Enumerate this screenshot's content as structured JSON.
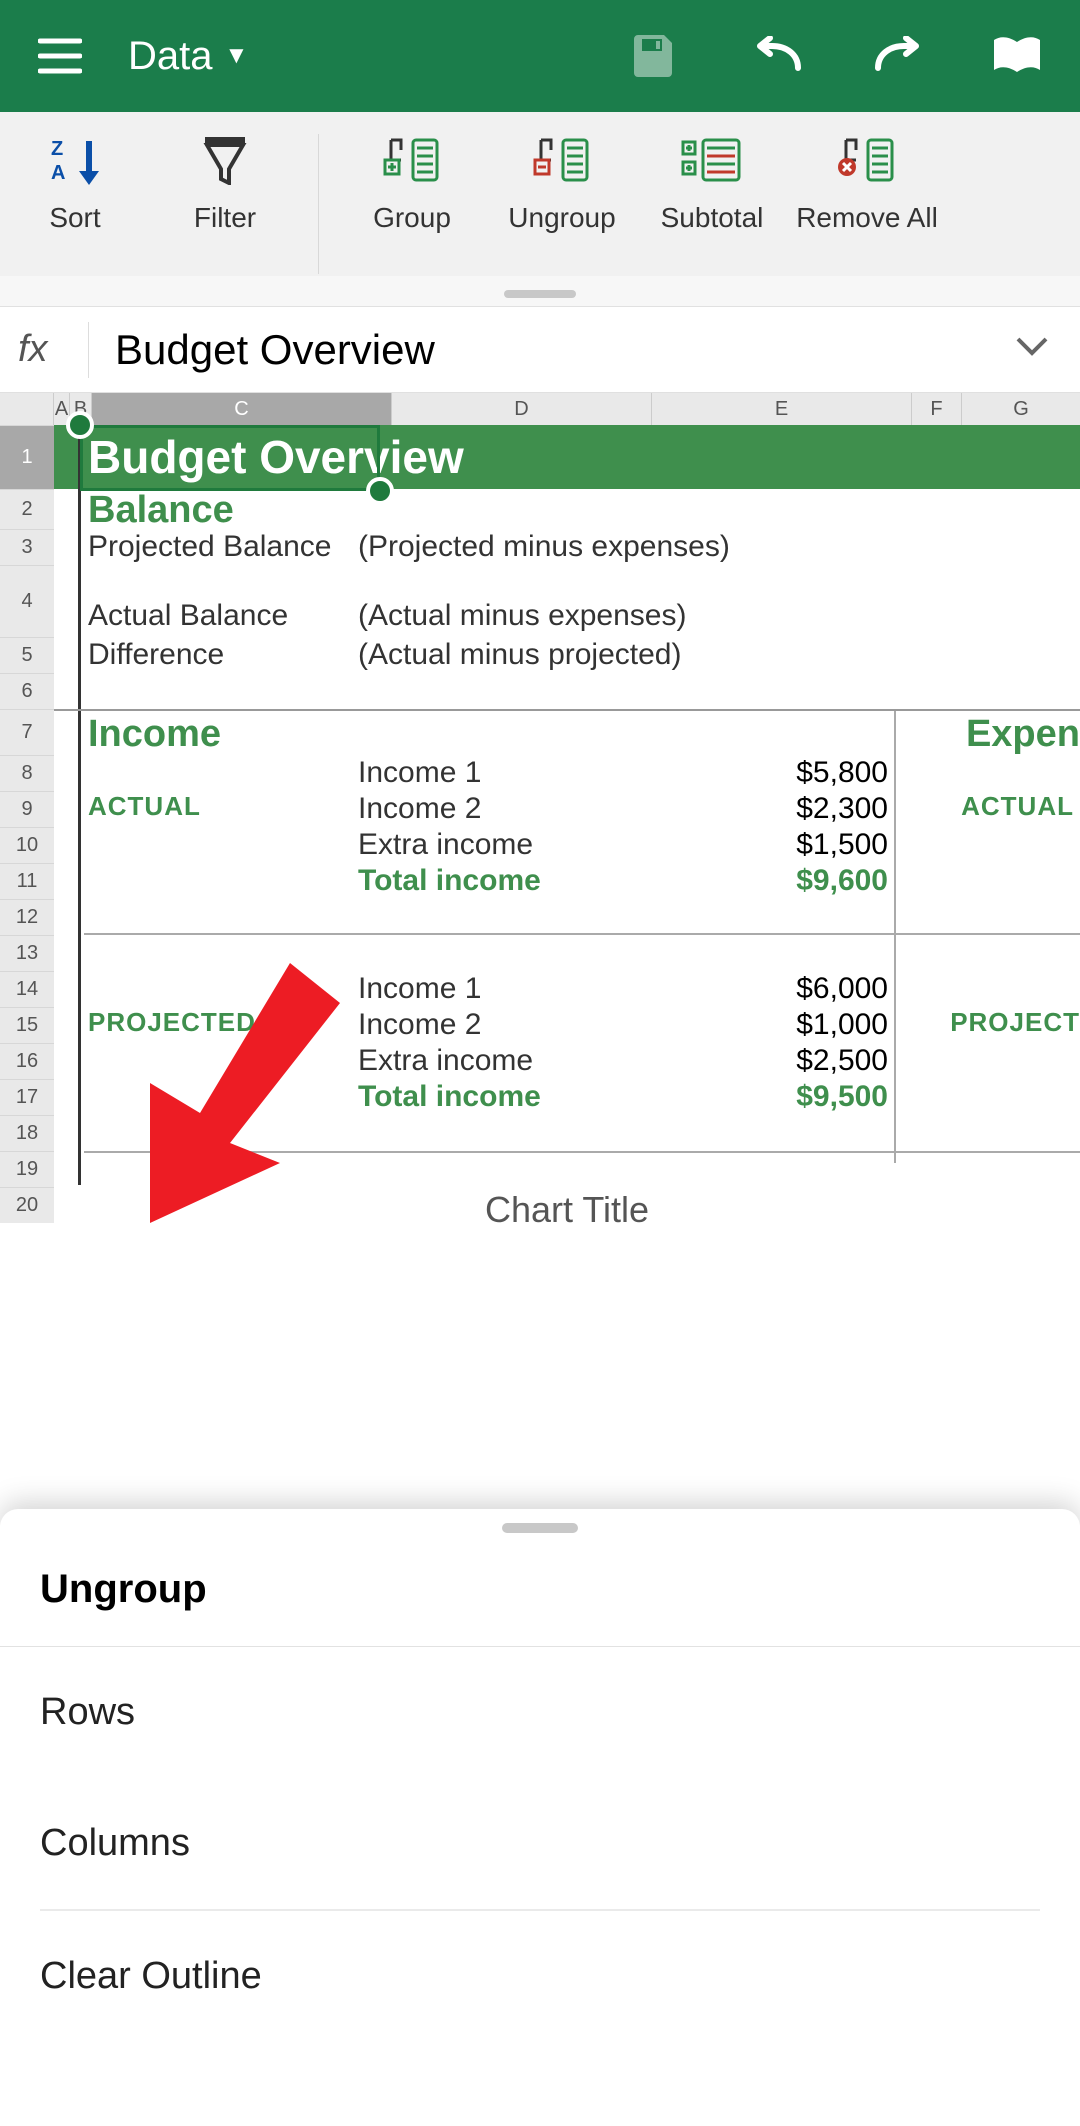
{
  "appbar": {
    "tab_label": "Data"
  },
  "ribbon": {
    "sort": "Sort",
    "filter": "Filter",
    "group": "Group",
    "ungroup": "Ungroup",
    "subtotal": "Subtotal",
    "remove_all": "Remove All"
  },
  "formula_bar": {
    "value": "Budget Overview"
  },
  "columns": [
    "A",
    "B",
    "C",
    "D",
    "E",
    "F",
    "G"
  ],
  "rows": [
    "1",
    "2",
    "3",
    "4",
    "5",
    "6",
    "7",
    "8",
    "9",
    "10",
    "11",
    "12",
    "13",
    "14",
    "15",
    "16",
    "17",
    "18",
    "19",
    "20"
  ],
  "sheet": {
    "title": "Budget Overview",
    "balance_heading": "Balance",
    "projected_balance_label": "Projected Balance",
    "projected_balance_note": "(Projected  minus expenses)",
    "actual_balance_label": "Actual Balance",
    "actual_balance_note": "(Actual  minus expenses)",
    "difference_label": "Difference",
    "difference_note": "(Actual minus projected)",
    "income_heading": "Income",
    "expenses_heading_partial": "Expen",
    "actual_label": "ACTUAL",
    "projected_label": "PROJECTED",
    "projected_label_partial": "PROJECT",
    "income_actual": [
      {
        "name": "Income 1",
        "value": "$5,800"
      },
      {
        "name": "Income 2",
        "value": "$2,300"
      },
      {
        "name": "Extra income",
        "value": "$1,500"
      }
    ],
    "income_actual_total_label": "Total income",
    "income_actual_total_value": "$9,600",
    "income_projected": [
      {
        "name": "Income 1",
        "value": "$6,000"
      },
      {
        "name": "Income 2",
        "value": "$1,000"
      },
      {
        "name": "Extra income",
        "value": "$2,500"
      }
    ],
    "income_projected_total_label": "Total income",
    "income_projected_total_value": "$9,500",
    "chart_title": "Chart Title"
  },
  "bottom_sheet": {
    "title": "Ungroup",
    "option_rows": "Rows",
    "option_columns": "Columns",
    "option_clear_outline": "Clear Outline"
  }
}
